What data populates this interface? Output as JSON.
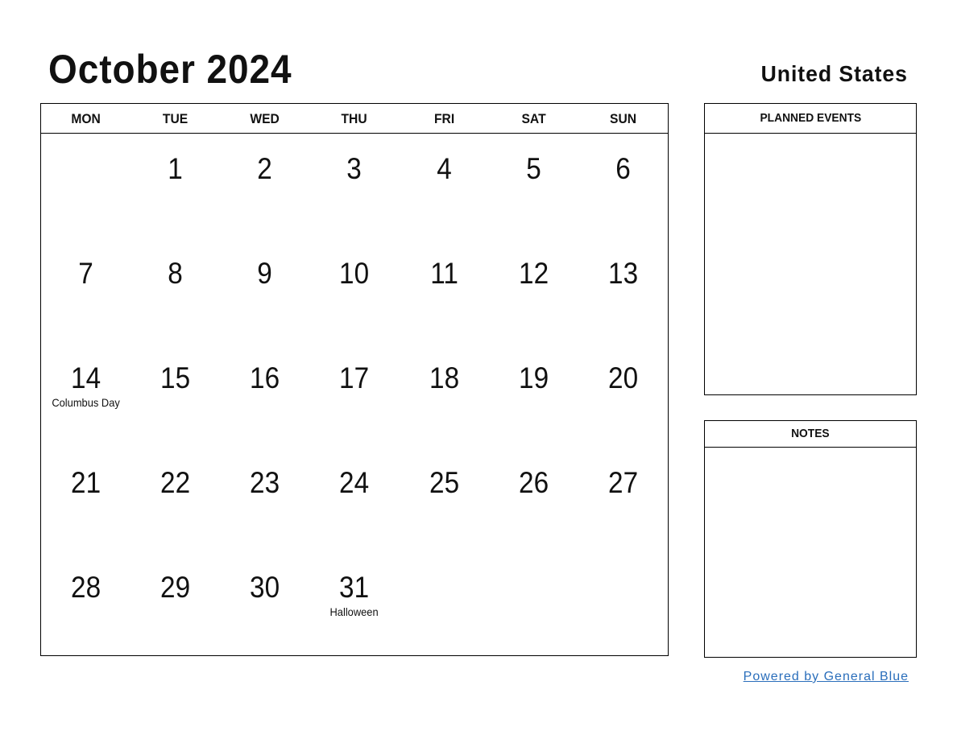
{
  "header": {
    "title": "October 2024",
    "country": "United States"
  },
  "calendar": {
    "weekdays": [
      "MON",
      "TUE",
      "WED",
      "THU",
      "FRI",
      "SAT",
      "SUN"
    ],
    "weeks": [
      [
        {
          "day": ""
        },
        {
          "day": "1"
        },
        {
          "day": "2"
        },
        {
          "day": "3"
        },
        {
          "day": "4"
        },
        {
          "day": "5"
        },
        {
          "day": "6"
        }
      ],
      [
        {
          "day": "7"
        },
        {
          "day": "8"
        },
        {
          "day": "9"
        },
        {
          "day": "10"
        },
        {
          "day": "11"
        },
        {
          "day": "12"
        },
        {
          "day": "13"
        }
      ],
      [
        {
          "day": "14",
          "holiday": "Columbus Day"
        },
        {
          "day": "15"
        },
        {
          "day": "16"
        },
        {
          "day": "17"
        },
        {
          "day": "18"
        },
        {
          "day": "19"
        },
        {
          "day": "20"
        }
      ],
      [
        {
          "day": "21"
        },
        {
          "day": "22"
        },
        {
          "day": "23"
        },
        {
          "day": "24"
        },
        {
          "day": "25"
        },
        {
          "day": "26"
        },
        {
          "day": "27"
        }
      ],
      [
        {
          "day": "28"
        },
        {
          "day": "29"
        },
        {
          "day": "30"
        },
        {
          "day": "31",
          "holiday": "Halloween"
        },
        {
          "day": ""
        },
        {
          "day": ""
        },
        {
          "day": ""
        }
      ]
    ]
  },
  "panels": {
    "planned_events": "PLANNED EVENTS",
    "notes": "NOTES"
  },
  "footer": {
    "link_text": "Powered by General Blue",
    "link_color": "#2a6ebb"
  }
}
